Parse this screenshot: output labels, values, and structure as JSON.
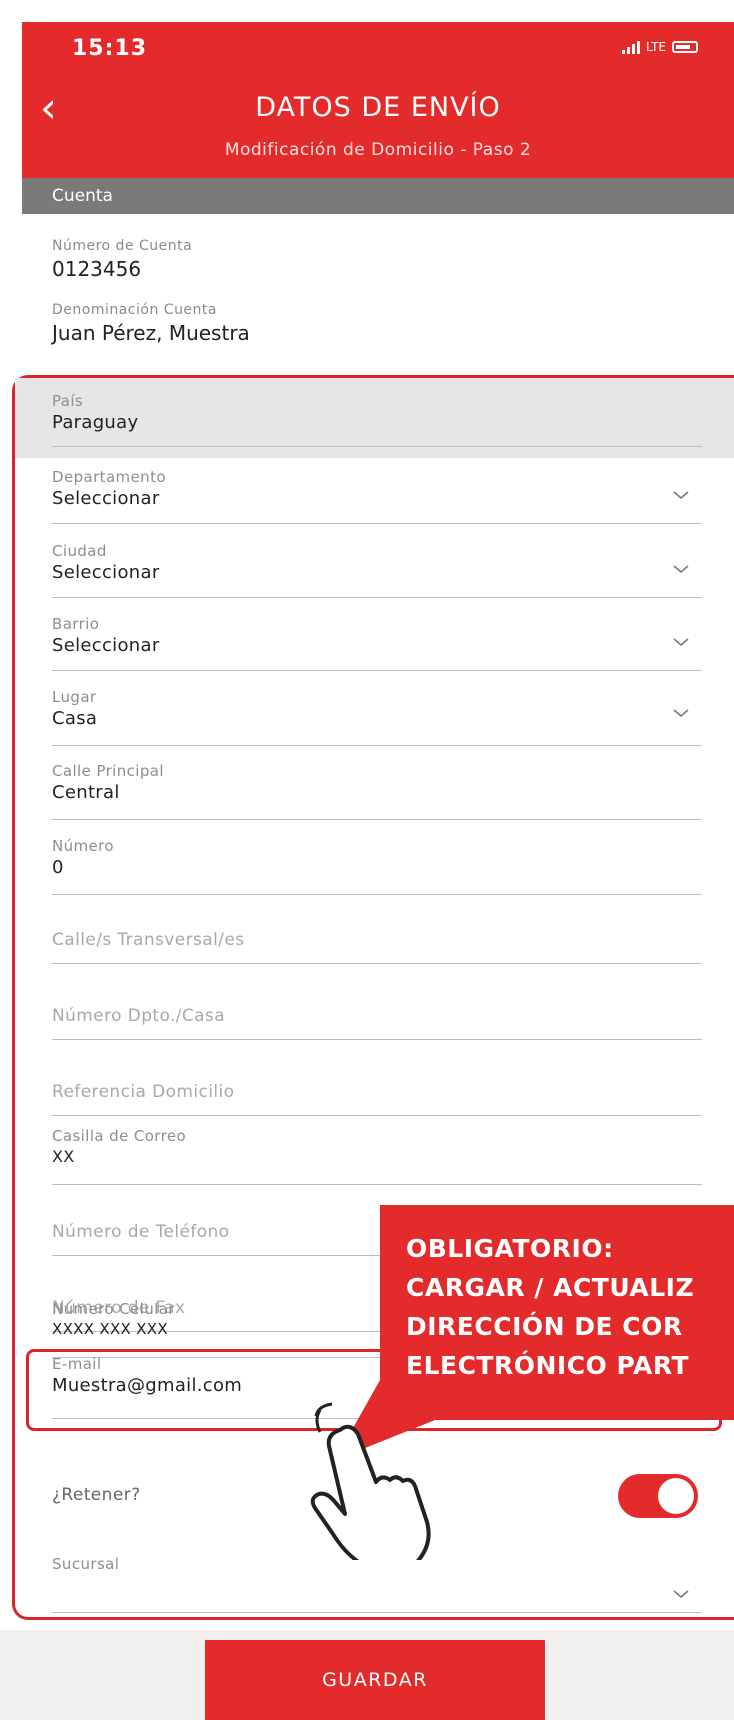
{
  "status_bar": {
    "time": "15:13",
    "network": "LTE"
  },
  "header": {
    "title": "DATOS DE ENVÍO",
    "subtitle": "Modificación de Domicilio - Paso 2"
  },
  "account_section": {
    "heading": "Cuenta",
    "account_number_label": "Número de Cuenta",
    "account_number": "0123456",
    "account_name_label": "Denominación Cuenta",
    "account_name": "Juan Pérez, Muestra"
  },
  "form": {
    "pais": {
      "label": "País",
      "value": "Paraguay"
    },
    "departamento": {
      "label": "Departamento",
      "value": "Seleccionar"
    },
    "ciudad": {
      "label": "Ciudad",
      "value": "Seleccionar"
    },
    "barrio": {
      "label": "Barrio",
      "value": "Seleccionar"
    },
    "lugar": {
      "label": "Lugar",
      "value": "Casa"
    },
    "calle_principal": {
      "label": "Calle Principal",
      "value": "Central"
    },
    "numero": {
      "label": "Número",
      "value": "0"
    },
    "calle_transversal": {
      "placeholder": "Calle/s Transversal/es"
    },
    "numero_dpto": {
      "placeholder": "Número Dpto./Casa"
    },
    "referencia": {
      "placeholder": "Referencia Domicilio"
    },
    "casilla": {
      "label": "Casilla de Correo",
      "value": "XX"
    },
    "telefono": {
      "placeholder": "Número de Teléfono"
    },
    "fax": {
      "placeholder": "Número de Fax"
    },
    "celular": {
      "label": "Número Celular",
      "value": "XXXX XXX XXX"
    },
    "email": {
      "label": "E-mail",
      "value": "Muestra@gmail.com"
    },
    "retener": {
      "label": "¿Retener?",
      "on": true
    },
    "sucursal": {
      "label": "Sucursal"
    }
  },
  "callout": {
    "lines": [
      "OBLIGATORIO:",
      "CARGAR / ACTUALIZ",
      "DIRECCIÓN DE COR",
      "ELECTRÓNICO PART"
    ]
  },
  "actions": {
    "save_label": "GUARDAR"
  },
  "colors": {
    "brand_red": "#e32b2b",
    "section_gray": "#7a7a7a",
    "highlight_red": "#d9262a"
  },
  "icons": [
    "back-chevron-icon",
    "chevron-down-icon",
    "signal-icon",
    "battery-icon",
    "hand-pointer-icon"
  ]
}
